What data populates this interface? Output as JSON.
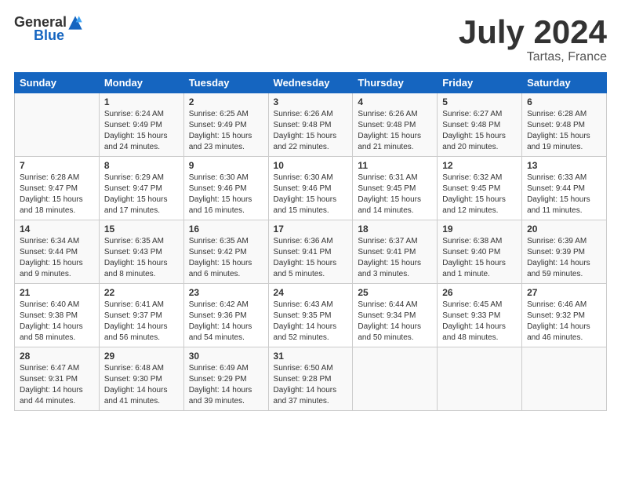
{
  "header": {
    "logo_general": "General",
    "logo_blue": "Blue",
    "month_title": "July 2024",
    "location": "Tartas, France"
  },
  "days_of_week": [
    "Sunday",
    "Monday",
    "Tuesday",
    "Wednesday",
    "Thursday",
    "Friday",
    "Saturday"
  ],
  "weeks": [
    [
      {
        "day": "",
        "info": ""
      },
      {
        "day": "1",
        "info": "Sunrise: 6:24 AM\nSunset: 9:49 PM\nDaylight: 15 hours\nand 24 minutes."
      },
      {
        "day": "2",
        "info": "Sunrise: 6:25 AM\nSunset: 9:49 PM\nDaylight: 15 hours\nand 23 minutes."
      },
      {
        "day": "3",
        "info": "Sunrise: 6:26 AM\nSunset: 9:48 PM\nDaylight: 15 hours\nand 22 minutes."
      },
      {
        "day": "4",
        "info": "Sunrise: 6:26 AM\nSunset: 9:48 PM\nDaylight: 15 hours\nand 21 minutes."
      },
      {
        "day": "5",
        "info": "Sunrise: 6:27 AM\nSunset: 9:48 PM\nDaylight: 15 hours\nand 20 minutes."
      },
      {
        "day": "6",
        "info": "Sunrise: 6:28 AM\nSunset: 9:48 PM\nDaylight: 15 hours\nand 19 minutes."
      }
    ],
    [
      {
        "day": "7",
        "info": "Sunrise: 6:28 AM\nSunset: 9:47 PM\nDaylight: 15 hours\nand 18 minutes."
      },
      {
        "day": "8",
        "info": "Sunrise: 6:29 AM\nSunset: 9:47 PM\nDaylight: 15 hours\nand 17 minutes."
      },
      {
        "day": "9",
        "info": "Sunrise: 6:30 AM\nSunset: 9:46 PM\nDaylight: 15 hours\nand 16 minutes."
      },
      {
        "day": "10",
        "info": "Sunrise: 6:30 AM\nSunset: 9:46 PM\nDaylight: 15 hours\nand 15 minutes."
      },
      {
        "day": "11",
        "info": "Sunrise: 6:31 AM\nSunset: 9:45 PM\nDaylight: 15 hours\nand 14 minutes."
      },
      {
        "day": "12",
        "info": "Sunrise: 6:32 AM\nSunset: 9:45 PM\nDaylight: 15 hours\nand 12 minutes."
      },
      {
        "day": "13",
        "info": "Sunrise: 6:33 AM\nSunset: 9:44 PM\nDaylight: 15 hours\nand 11 minutes."
      }
    ],
    [
      {
        "day": "14",
        "info": "Sunrise: 6:34 AM\nSunset: 9:44 PM\nDaylight: 15 hours\nand 9 minutes."
      },
      {
        "day": "15",
        "info": "Sunrise: 6:35 AM\nSunset: 9:43 PM\nDaylight: 15 hours\nand 8 minutes."
      },
      {
        "day": "16",
        "info": "Sunrise: 6:35 AM\nSunset: 9:42 PM\nDaylight: 15 hours\nand 6 minutes."
      },
      {
        "day": "17",
        "info": "Sunrise: 6:36 AM\nSunset: 9:41 PM\nDaylight: 15 hours\nand 5 minutes."
      },
      {
        "day": "18",
        "info": "Sunrise: 6:37 AM\nSunset: 9:41 PM\nDaylight: 15 hours\nand 3 minutes."
      },
      {
        "day": "19",
        "info": "Sunrise: 6:38 AM\nSunset: 9:40 PM\nDaylight: 15 hours\nand 1 minute."
      },
      {
        "day": "20",
        "info": "Sunrise: 6:39 AM\nSunset: 9:39 PM\nDaylight: 14 hours\nand 59 minutes."
      }
    ],
    [
      {
        "day": "21",
        "info": "Sunrise: 6:40 AM\nSunset: 9:38 PM\nDaylight: 14 hours\nand 58 minutes."
      },
      {
        "day": "22",
        "info": "Sunrise: 6:41 AM\nSunset: 9:37 PM\nDaylight: 14 hours\nand 56 minutes."
      },
      {
        "day": "23",
        "info": "Sunrise: 6:42 AM\nSunset: 9:36 PM\nDaylight: 14 hours\nand 54 minutes."
      },
      {
        "day": "24",
        "info": "Sunrise: 6:43 AM\nSunset: 9:35 PM\nDaylight: 14 hours\nand 52 minutes."
      },
      {
        "day": "25",
        "info": "Sunrise: 6:44 AM\nSunset: 9:34 PM\nDaylight: 14 hours\nand 50 minutes."
      },
      {
        "day": "26",
        "info": "Sunrise: 6:45 AM\nSunset: 9:33 PM\nDaylight: 14 hours\nand 48 minutes."
      },
      {
        "day": "27",
        "info": "Sunrise: 6:46 AM\nSunset: 9:32 PM\nDaylight: 14 hours\nand 46 minutes."
      }
    ],
    [
      {
        "day": "28",
        "info": "Sunrise: 6:47 AM\nSunset: 9:31 PM\nDaylight: 14 hours\nand 44 minutes."
      },
      {
        "day": "29",
        "info": "Sunrise: 6:48 AM\nSunset: 9:30 PM\nDaylight: 14 hours\nand 41 minutes."
      },
      {
        "day": "30",
        "info": "Sunrise: 6:49 AM\nSunset: 9:29 PM\nDaylight: 14 hours\nand 39 minutes."
      },
      {
        "day": "31",
        "info": "Sunrise: 6:50 AM\nSunset: 9:28 PM\nDaylight: 14 hours\nand 37 minutes."
      },
      {
        "day": "",
        "info": ""
      },
      {
        "day": "",
        "info": ""
      },
      {
        "day": "",
        "info": ""
      }
    ]
  ]
}
